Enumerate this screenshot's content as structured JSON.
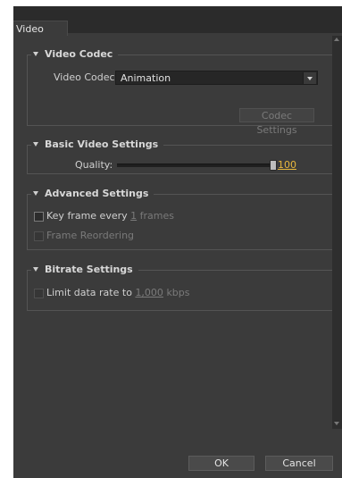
{
  "tab": {
    "label": "Video"
  },
  "video_codec": {
    "header": "Video Codec",
    "codec_label": "Video Codec:",
    "codec_value": "Animation",
    "codec_settings_button": "Codec Settings"
  },
  "basic_video": {
    "header": "Basic Video Settings",
    "quality_label": "Quality:",
    "quality_value": "100",
    "quality_fraction": 1.0
  },
  "advanced": {
    "header": "Advanced Settings",
    "key_frame_label": "Key frame every",
    "key_frame_value": "1",
    "key_frame_unit": "frames",
    "frame_reordering_label": "Frame Reordering"
  },
  "bitrate": {
    "header": "Bitrate Settings",
    "limit_label": "Limit data rate to",
    "limit_value": "1,000",
    "limit_unit": "kbps"
  },
  "footer": {
    "ok": "OK",
    "cancel": "Cancel"
  },
  "colors": {
    "accent": "#e8b73d",
    "panel": "#3b3b3b",
    "tabstrip": "#2b2b2b"
  }
}
